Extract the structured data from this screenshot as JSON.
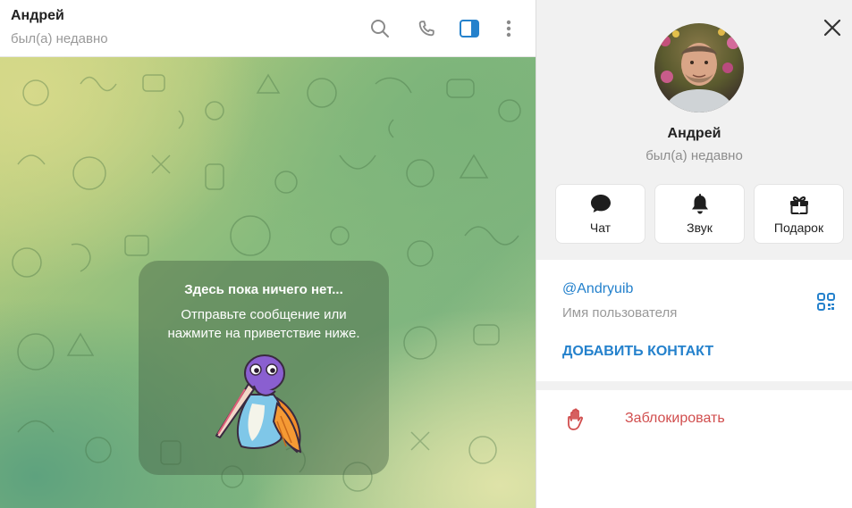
{
  "chat": {
    "title": "Андрей",
    "status": "был(а) недавно",
    "header_icons": [
      "search-icon",
      "phone-icon",
      "sidebar-toggle-icon",
      "more-vert-icon"
    ],
    "empty": {
      "title": "Здесь пока ничего нет...",
      "line1": "Отправьте сообщение или",
      "line2": "нажмите на приветствие ниже."
    }
  },
  "profile": {
    "name": "Андрей",
    "status": "был(а) недавно",
    "actions": [
      {
        "label": "Чат",
        "icon": "chat-bubble-icon"
      },
      {
        "label": "Звук",
        "icon": "bell-icon"
      },
      {
        "label": "Подарок",
        "icon": "gift-icon"
      }
    ],
    "username": "@Andryuib",
    "username_label": "Имя пользователя",
    "add_contact": "ДОБАВИТЬ КОНТАКТ",
    "block": "Заблокировать"
  },
  "colors": {
    "accent": "#2481cc",
    "danger": "#d14e4e",
    "active_icon": "#2481cc"
  }
}
